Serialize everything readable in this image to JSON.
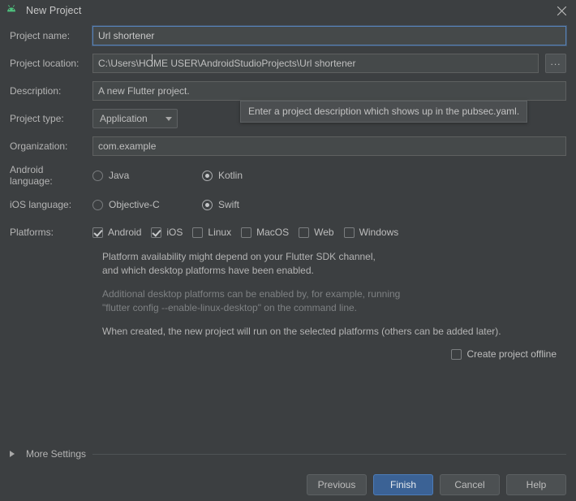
{
  "window": {
    "title": "New Project",
    "icon": "android-head-icon",
    "close_icon": "close-icon",
    "accent_blue": "#3b6295",
    "background": "#3c3f41"
  },
  "form": {
    "project_name": {
      "label": "Project name:",
      "value": "Url shortener",
      "focused": true
    },
    "project_location": {
      "label": "Project location:",
      "value": "C:\\Users\\HOME USER\\AndroidStudioProjects\\Url shortener",
      "browse_label": "..."
    },
    "description": {
      "label": "Description:",
      "value": "A new Flutter project."
    },
    "project_type": {
      "label": "Project type:",
      "value": "Application"
    },
    "organization": {
      "label": "Organization:",
      "value": "com.example"
    },
    "android_language": {
      "label": "Android language:",
      "options": [
        {
          "label": "Java",
          "selected": false
        },
        {
          "label": "Kotlin",
          "selected": true
        }
      ]
    },
    "ios_language": {
      "label": "iOS language:",
      "options": [
        {
          "label": "Objective-C",
          "selected": false
        },
        {
          "label": "Swift",
          "selected": true
        }
      ]
    },
    "platforms": {
      "label": "Platforms:",
      "options": [
        {
          "label": "Android",
          "checked": true
        },
        {
          "label": "iOS",
          "checked": true
        },
        {
          "label": "Linux",
          "checked": false
        },
        {
          "label": "MacOS",
          "checked": false
        },
        {
          "label": "Web",
          "checked": false
        },
        {
          "label": "Windows",
          "checked": false
        }
      ]
    }
  },
  "tooltip": {
    "text": "Enter a project description which shows up in the pubsec.yaml."
  },
  "notes": {
    "line1": "Platform availability might depend on your Flutter SDK channel,",
    "line2": "and which desktop platforms have been enabled.",
    "line3": "Additional desktop platforms can be enabled by, for example, running",
    "line4": "\"flutter config --enable-linux-desktop\" on the command line.",
    "line5": "When created, the new project will run on the selected platforms (others can be added later)."
  },
  "offline": {
    "label": "Create project offline",
    "checked": false
  },
  "footer": {
    "more_settings": "More Settings",
    "buttons": [
      {
        "label": "Previous",
        "primary": false
      },
      {
        "label": "Finish",
        "primary": true
      },
      {
        "label": "Cancel",
        "primary": false
      },
      {
        "label": "Help",
        "primary": false
      }
    ]
  }
}
